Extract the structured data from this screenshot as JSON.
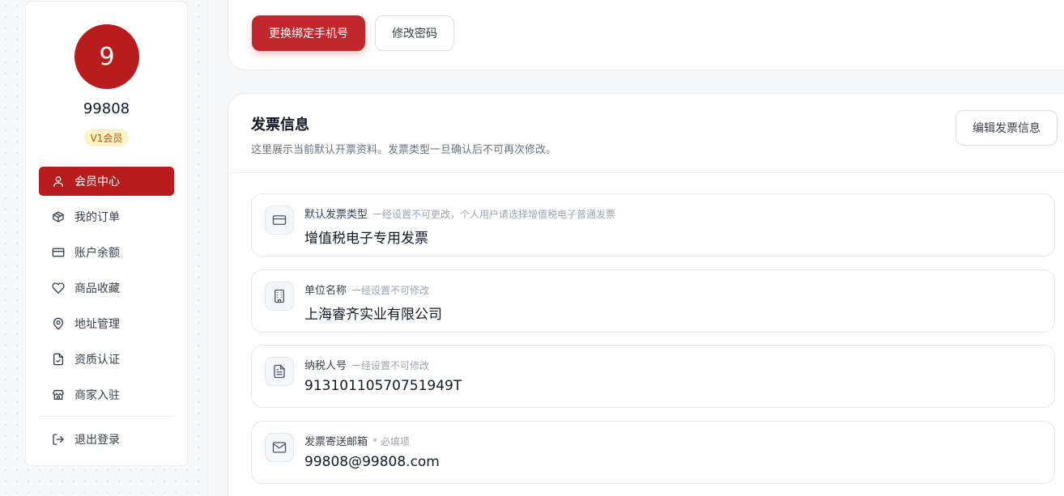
{
  "profile": {
    "avatar_letter": "9",
    "username": "99808",
    "level_badge": "V1会员"
  },
  "nav": {
    "items": [
      {
        "label": "会员中心",
        "icon": "user-icon",
        "active": true
      },
      {
        "label": "我的订单",
        "icon": "package-icon"
      },
      {
        "label": "账户余额",
        "icon": "credit-card-icon"
      },
      {
        "label": "商品收藏",
        "icon": "heart-icon"
      },
      {
        "label": "地址管理",
        "icon": "map-pin-icon"
      },
      {
        "label": "资质认证",
        "icon": "file-check-icon"
      },
      {
        "label": "商家入驻",
        "icon": "store-icon"
      }
    ],
    "logout": {
      "label": "退出登录",
      "icon": "logout-icon"
    }
  },
  "account": {
    "change_phone_label": "更换绑定手机号",
    "change_password_label": "修改密码"
  },
  "invoice": {
    "title": "发票信息",
    "description": "这里展示当前默认开票资料。发票类型一旦确认后不可再次修改。",
    "edit_label": "编辑发票信息",
    "fields": [
      {
        "label": "默认发票类型",
        "hint": "一经设置不可更改，个人用户请选择增值税电子普通发票",
        "value": "增值税电子专用发票",
        "icon": "credit-card-icon"
      },
      {
        "label": "单位名称",
        "hint": "一经设置不可修改",
        "value": "上海睿齐实业有限公司",
        "icon": "building-icon"
      },
      {
        "label": "纳税人号",
        "hint": "一经设置不可修改",
        "value": "91310110570751949T",
        "icon": "document-icon"
      },
      {
        "label": "发票寄送邮箱",
        "hint": "* 必填项",
        "value": "99808@99808.com",
        "icon": "mail-icon"
      }
    ]
  },
  "colors": {
    "brand_red": "#b91c1c",
    "primary_button": "#c0282d",
    "badge_bg": "#fef3c7",
    "badge_text": "#b45309"
  }
}
